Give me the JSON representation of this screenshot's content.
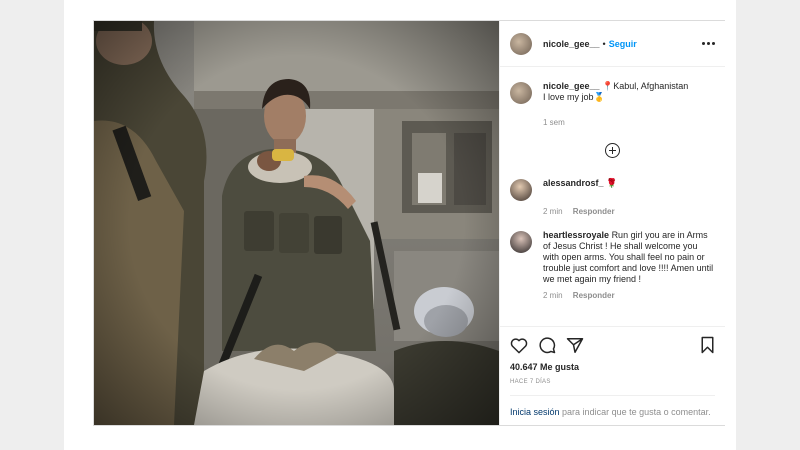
{
  "post": {
    "photo_alt": "",
    "header": {
      "username": "nicole_gee__",
      "separator": "•",
      "follow_label": "Seguir"
    },
    "caption": {
      "username": "nicole_gee__",
      "text": "📍Kabul, Afghanistan",
      "text2": "I love my job🥇",
      "time": "1 sem"
    },
    "comments": [
      {
        "username": "alessandrosf_",
        "text": "🌹",
        "time": "2 min",
        "reply_label": "Responder"
      },
      {
        "username": "heartlessroyale",
        "text": "Run girl you are in Arms of Jesus Christ ! He shall welcome you with open arms. You shall feel no pain or trouble just comfort and love !!!! Amen until we met again my friend !",
        "time": "2 min",
        "reply_label": "Responder"
      }
    ],
    "likes": "40.647 Me gusta",
    "posted_ago": "HACE 7 DÍAS",
    "login_link": "Inicia sesión",
    "login_text": "para indicar que te gusta o comentar."
  },
  "icons": {
    "more": "more-options-icon",
    "load_more": "plus-circle-icon",
    "like": "heart-icon",
    "comment": "comment-icon",
    "share": "paper-plane-icon",
    "save": "bookmark-icon"
  },
  "colors": {
    "link_blue": "#0095f6",
    "text": "#262626",
    "muted": "#8e8e8e",
    "border": "#dbdbdb"
  }
}
